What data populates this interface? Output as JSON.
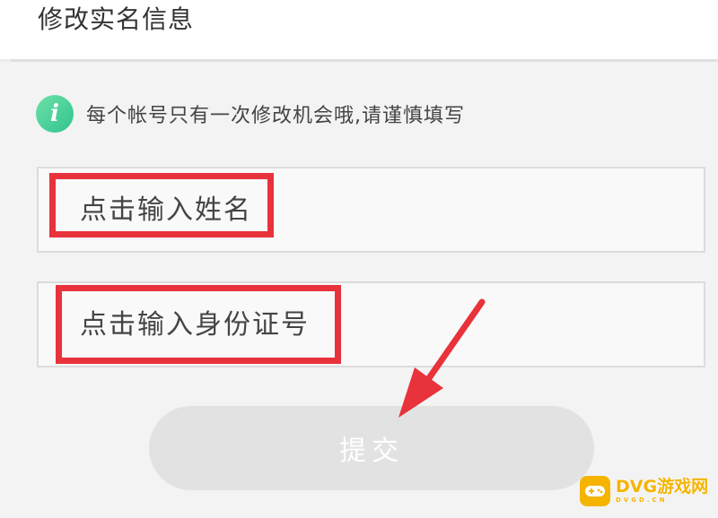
{
  "header": {
    "title": "修改实名信息"
  },
  "notice": {
    "icon": "info-icon",
    "icon_glyph": "i",
    "text": "每个帐号只有一次修改机会哦,请谨慎填写"
  },
  "form": {
    "name_field": {
      "placeholder": "点击输入姓名",
      "value": ""
    },
    "id_field": {
      "placeholder": "点击输入身份证号",
      "value": ""
    },
    "submit_label": "提交"
  },
  "annotations": {
    "highlight_color": "#e8323c",
    "arrow_color": "#e8323c",
    "arrow_target": "submit-button"
  },
  "watermark": {
    "text": "DVG游戏网",
    "subtext": "DVGD.CN",
    "color": "#f5b400"
  },
  "colors": {
    "accent": "#2fc48f",
    "button_disabled": "#e2e2e2"
  }
}
